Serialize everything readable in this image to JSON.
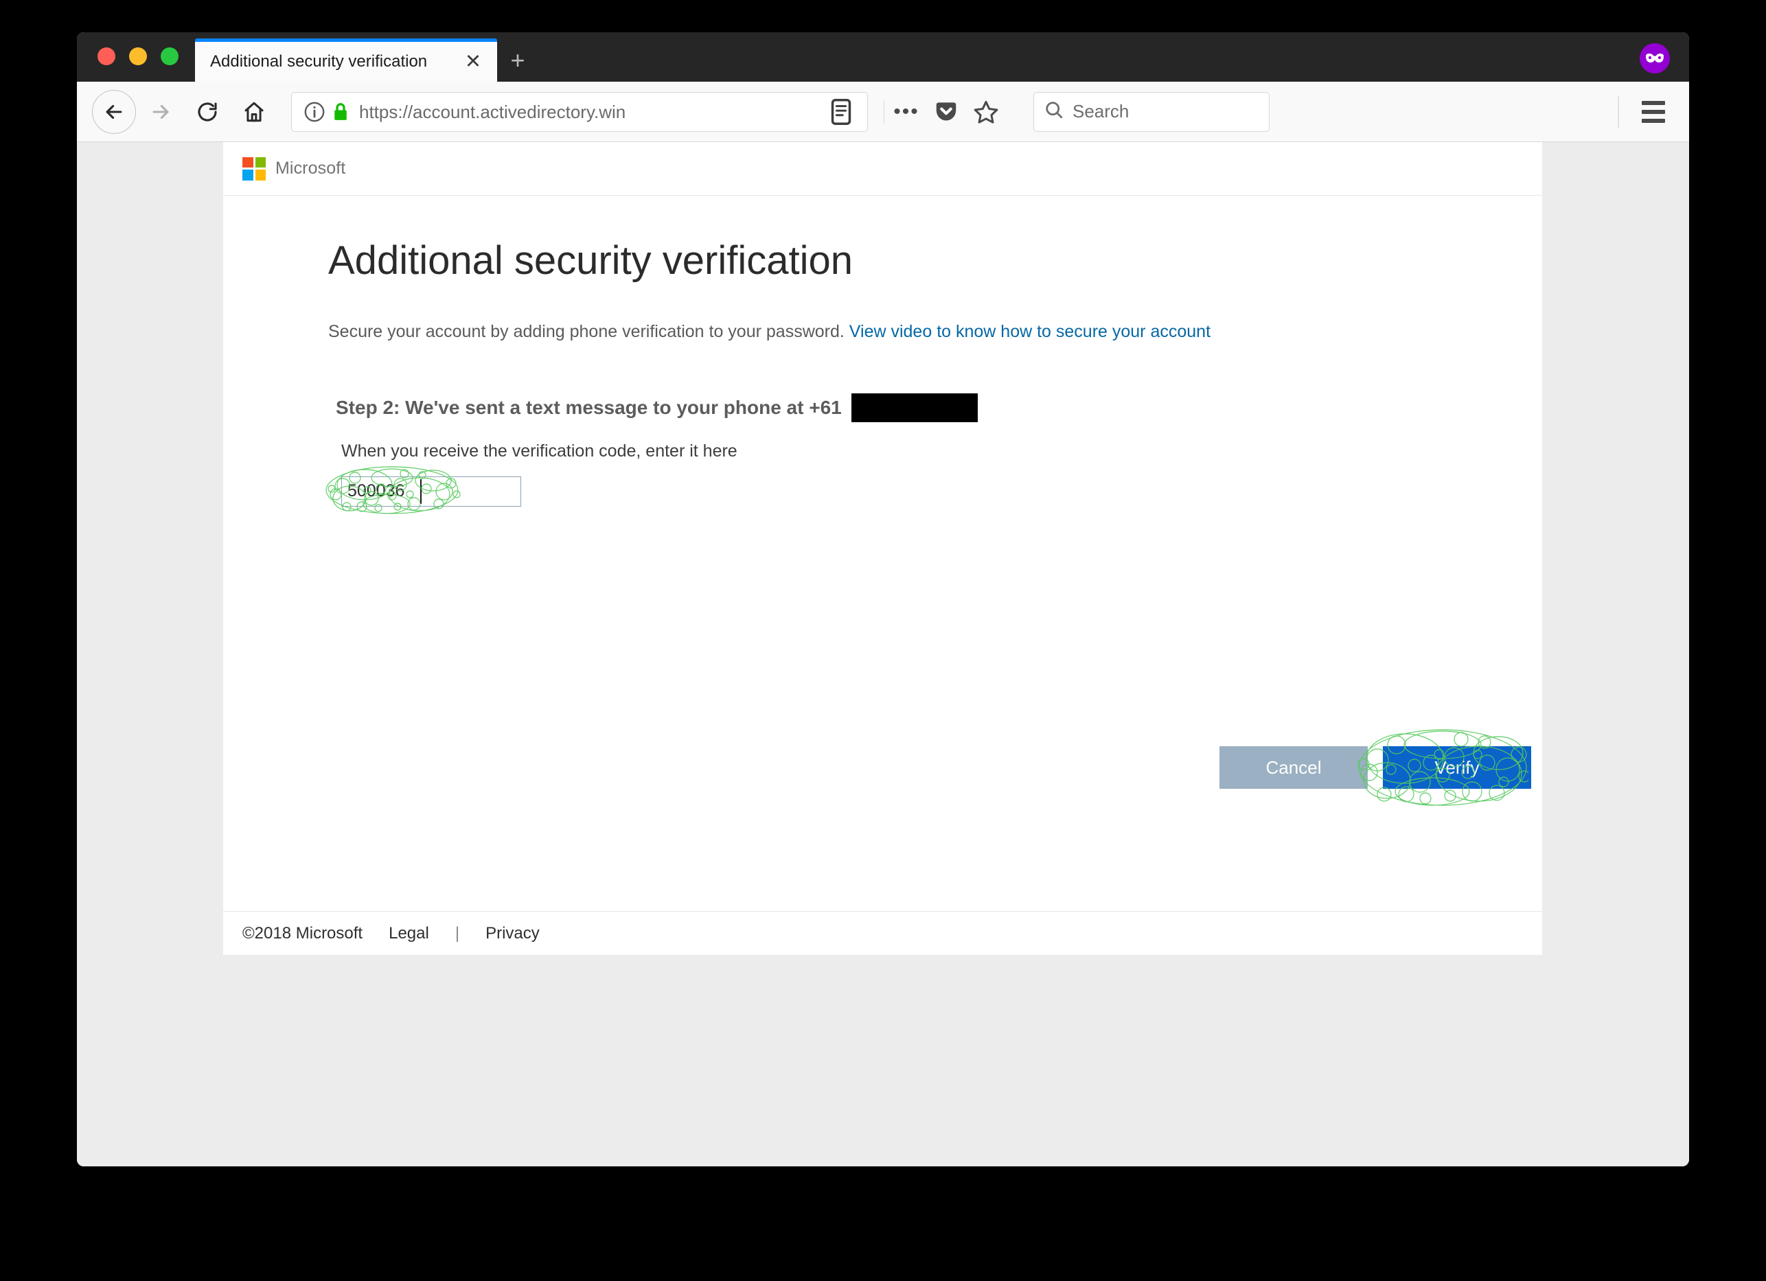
{
  "browser": {
    "window_controls": [
      "close",
      "minimize",
      "maximize"
    ],
    "tab": {
      "title": "Additional security verification",
      "close_label": "✕"
    },
    "new_tab_label": "+",
    "private_badge_name": "mask-icon",
    "nav": {
      "back_label": "Back",
      "forward_label": "Forward",
      "reload_label": "Reload",
      "home_label": "Home"
    },
    "url": {
      "value": "https://account.activedirectory.win",
      "identity_icon": "info-icon",
      "lock_icon": "lock-icon",
      "reader_icon": "reader-view-icon"
    },
    "page_actions": {
      "more_label": "•••",
      "pocket_icon": "pocket-icon",
      "bookmark_icon": "star-icon"
    },
    "search": {
      "placeholder": "Search",
      "icon": "search-icon"
    },
    "menu_label": "Open menu"
  },
  "page": {
    "brand": {
      "wordmark": "Microsoft",
      "logo_colors": [
        "#f25022",
        "#7fba00",
        "#00a4ef",
        "#ffb900"
      ]
    },
    "heading": "Additional security verification",
    "subtitle_text": "Secure your account by adding phone verification to your password.",
    "video_link": "View video to know how to secure your account",
    "step_heading": "Step 2: We've sent a text message to your phone at +61",
    "phone_redacted": "",
    "code_label": "When you receive the verification code, enter it here",
    "code_value": "500036",
    "buttons": {
      "cancel": "Cancel",
      "verify": "Verify"
    },
    "footer": {
      "copyright": "©2018 Microsoft",
      "legal": "Legal",
      "separator": "|",
      "privacy": "Privacy"
    }
  },
  "annotations": {
    "highlight_color": "#4dc94d",
    "targets": [
      "code-input",
      "verify-button"
    ]
  },
  "colors": {
    "accent_blue": "#0a63c9",
    "cancel_gray": "#9bb0c2",
    "link_blue": "#0668a5",
    "page_bg": "#ececec",
    "chrome_dark": "#262626"
  }
}
